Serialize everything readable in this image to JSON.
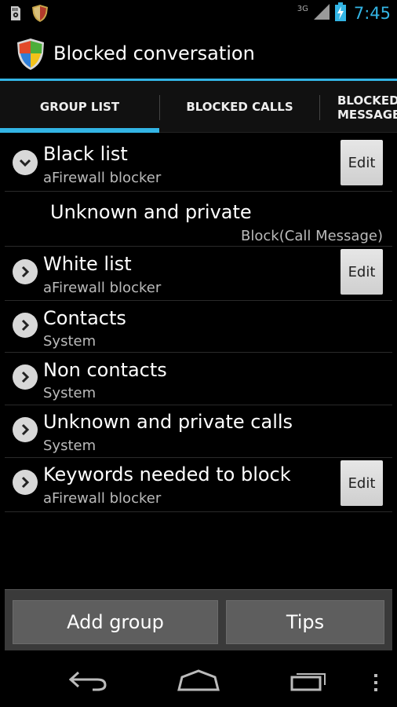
{
  "app": {
    "title": "Blocked conversation"
  },
  "status_bar": {
    "network": "3G",
    "time": "7:45"
  },
  "tabs": [
    {
      "label": "GROUP LIST",
      "selected": true
    },
    {
      "label": "BLOCKED CALLS",
      "selected": false
    },
    {
      "label_line1": "BLOCKED",
      "label_line2": "MESSAGES",
      "selected": false
    }
  ],
  "groups": [
    {
      "title": "Black list",
      "subtitle": "aFirewall blocker",
      "expanded": true,
      "edit_label": "Edit"
    },
    {
      "title": "Unknown and private",
      "subtitle": "Block(Call Message)"
    },
    {
      "title": "White list",
      "subtitle": "aFirewall blocker",
      "expanded": false,
      "edit_label": "Edit"
    },
    {
      "title": "Contacts",
      "subtitle": "System",
      "expanded": false
    },
    {
      "title": "Non contacts",
      "subtitle": "System",
      "expanded": false
    },
    {
      "title": "Unknown and private calls",
      "subtitle": "System",
      "expanded": false
    },
    {
      "title": "Keywords needed to block",
      "subtitle": "aFirewall blocker",
      "expanded": false,
      "edit_label": "Edit"
    }
  ],
  "buttons": {
    "add_group": "Add group",
    "tips": "Tips"
  },
  "colors": {
    "accent": "#33b5e5",
    "background": "#000000",
    "button_bar": "#3a3a3a"
  }
}
